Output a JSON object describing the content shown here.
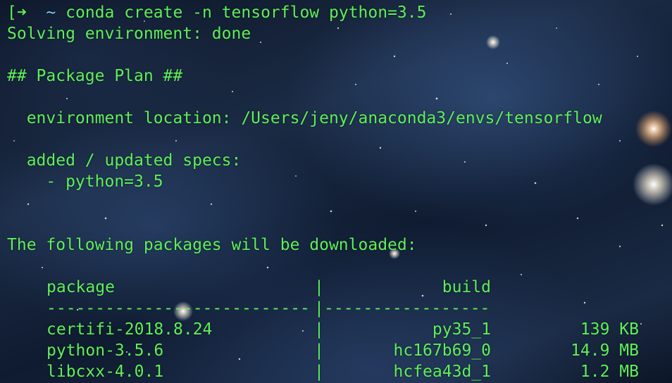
{
  "terminal": {
    "prompt": {
      "arrow": "[➜",
      "tilde": "~",
      "command": "conda create -n tensorflow python=3.5"
    },
    "lines": {
      "solving": "Solving environment: done",
      "plan_header": "## Package Plan ##",
      "env_location": "  environment location: /Users/jeny/anaconda3/envs/tensorflow",
      "specs_header": "  added / updated specs:",
      "spec_item": "    - python=3.5",
      "download_header": "The following packages will be downloaded:"
    },
    "table": {
      "headers": {
        "package": "package",
        "build": "build",
        "divider": "|"
      },
      "rule_left": "---------------------------",
      "rule_mid": "|",
      "rule_right": "-----------------",
      "rows": [
        {
          "package": "certifi-2018.8.24",
          "divider": "|",
          "build": "py35_1",
          "size": "139 KB"
        },
        {
          "package": "python-3.5.6",
          "divider": "|",
          "build": "hc167b69_0",
          "size": "14.9 MB"
        },
        {
          "package": "libcxx-4.0.1",
          "divider": "|",
          "build": "hcfea43d_1",
          "size": "1.2 MB"
        }
      ]
    },
    "colors": {
      "text_green": "#5ff05a",
      "tilde_cyan": "#6fd4ff",
      "background_space": "#1b2b45"
    }
  }
}
